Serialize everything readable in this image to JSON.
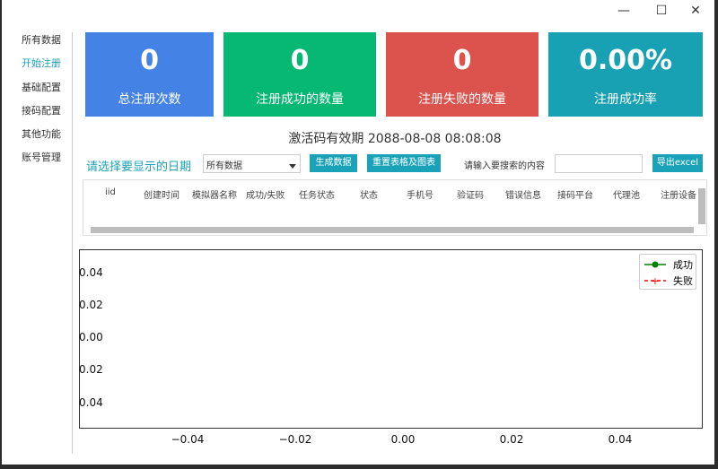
{
  "window": {
    "minimize": "—",
    "maximize": "☐",
    "close": "✕"
  },
  "sidebar": {
    "items": [
      {
        "label": "所有数据"
      },
      {
        "label": "开始注册",
        "active": true
      },
      {
        "label": "基础配置"
      },
      {
        "label": "接码配置"
      },
      {
        "label": "其他功能"
      },
      {
        "label": "账号管理"
      }
    ]
  },
  "cards": [
    {
      "value": "0",
      "label": "总注册次数",
      "color": "#4582e6"
    },
    {
      "value": "0",
      "label": "注册成功的数量",
      "color": "#07b873"
    },
    {
      "value": "0",
      "label": "注册失败的数量",
      "color": "#dc524d"
    },
    {
      "value": "0.00%",
      "label": "注册成功率",
      "color": "#17a1b3"
    }
  ],
  "expire": "激活码有效期 2088-08-08 08:08:08",
  "toolbar": {
    "date_label": "请选择要显示的日期",
    "date_select": "所有数据",
    "generate": "生成数据",
    "reset": "重置表格及图表",
    "search_label": "请输入要搜索的内容",
    "search_value": "",
    "export": "导出excel"
  },
  "table": {
    "columns": [
      "iid",
      "创建时间",
      "模拟器名称",
      "成功/失败",
      "任务状态",
      "状态",
      "手机号",
      "验证码",
      "错误信息",
      "接码平台",
      "代理池",
      "注册设备"
    ]
  },
  "chart_data": {
    "type": "line",
    "series": [
      {
        "name": "成功",
        "values": [],
        "color": "#008000"
      },
      {
        "name": "失败",
        "values": [],
        "color": "#ff0000"
      }
    ],
    "yticks": [
      "0.04",
      "0.02",
      "0.00",
      "0.02",
      "0.04"
    ],
    "xticks": [
      "−0.04",
      "−0.02",
      "0.00",
      "0.02",
      "0.04"
    ],
    "xlim": [
      -0.055,
      0.055
    ],
    "ylim": [
      -0.055,
      0.055
    ],
    "legend": "top-right"
  }
}
